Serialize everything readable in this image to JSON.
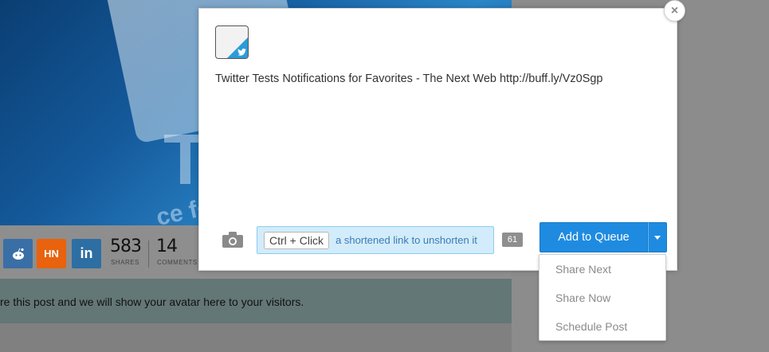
{
  "social": {
    "buttons": [
      {
        "name": "reddit",
        "label": "",
        "color": "#3a6fa6"
      },
      {
        "name": "hn",
        "label": "HN",
        "color": "#e9620d"
      },
      {
        "name": "linkedin",
        "label": "in",
        "color": "#2d6ea3"
      }
    ],
    "shares_count": "583",
    "shares_label": "SHARES",
    "comments_count": "14",
    "comments_label": "COMMENTS"
  },
  "banner": {
    "text": "re this post and we will show your avatar here to your visitors."
  },
  "composer": {
    "post_text": "Twitter Tests Notifications for Favorites - The Next Web http://buff.ly/Vz0Sgp",
    "hint_key": "Ctrl + Click",
    "hint_text": "a shortened link to unshorten it",
    "char_count": "61",
    "primary_action": "Add to Queue",
    "close_symbol": "×"
  },
  "dropdown": {
    "items": [
      "Share Next",
      "Share Now",
      "Schedule Post"
    ]
  },
  "colors": {
    "accent": "#1f8be0",
    "twitter": "#2d9bd9",
    "hint_bg": "#d2ecfb"
  }
}
